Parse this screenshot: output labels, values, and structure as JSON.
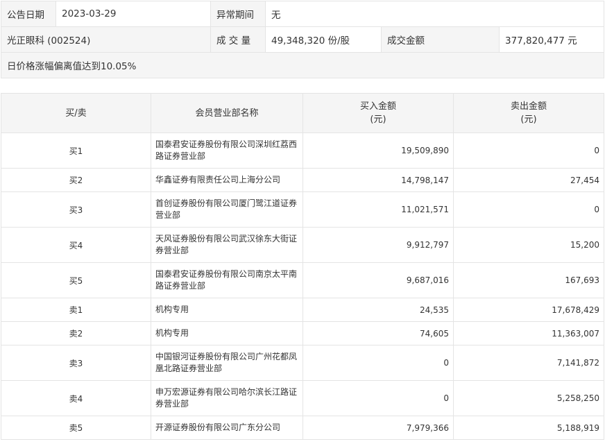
{
  "info": {
    "date_label": "公告日期",
    "date_value": "2023-03-29",
    "period_label": "异常期间",
    "period_value": "无",
    "stock": "光正眼科 (002524)",
    "volume_label": "成 交 量",
    "volume_value": "49,348,320 份/股",
    "amount_label": "成交金额",
    "amount_value": "377,820,477 元",
    "reason": "日价格涨幅偏离值达到10.05%"
  },
  "table": {
    "headers": {
      "side": "买/卖",
      "name": "会员营业部名称",
      "buy_line1": "买入金额",
      "buy_line2": "(元)",
      "sell_line1": "卖出金额",
      "sell_line2": "(元)"
    },
    "rows": [
      {
        "side": "买1",
        "name": "国泰君安证券股份有限公司深圳红荔西路证券营业部",
        "buy": "19,509,890",
        "sell": "0"
      },
      {
        "side": "买2",
        "name": "华鑫证券有限责任公司上海分公司",
        "buy": "14,798,147",
        "sell": "27,454"
      },
      {
        "side": "买3",
        "name": "首创证券股份有限公司厦门鹭江道证券营业部",
        "buy": "11,021,571",
        "sell": "0"
      },
      {
        "side": "买4",
        "name": "天风证券股份有限公司武汉徐东大街证券营业部",
        "buy": "9,912,797",
        "sell": "15,200"
      },
      {
        "side": "买5",
        "name": "国泰君安证券股份有限公司南京太平南路证券营业部",
        "buy": "9,687,016",
        "sell": "167,693"
      },
      {
        "side": "卖1",
        "name": "机构专用",
        "buy": "24,535",
        "sell": "17,678,429"
      },
      {
        "side": "卖2",
        "name": "机构专用",
        "buy": "74,605",
        "sell": "11,363,007"
      },
      {
        "side": "卖3",
        "name": "中国银河证券股份有限公司广州花都凤凰北路证券营业部",
        "buy": "0",
        "sell": "7,141,872"
      },
      {
        "side": "卖4",
        "name": "申万宏源证券有限公司哈尔滨长江路证券营业部",
        "buy": "0",
        "sell": "5,258,250"
      },
      {
        "side": "卖5",
        "name": "开源证券股份有限公司广东分公司",
        "buy": "7,979,366",
        "sell": "5,188,919"
      }
    ]
  }
}
